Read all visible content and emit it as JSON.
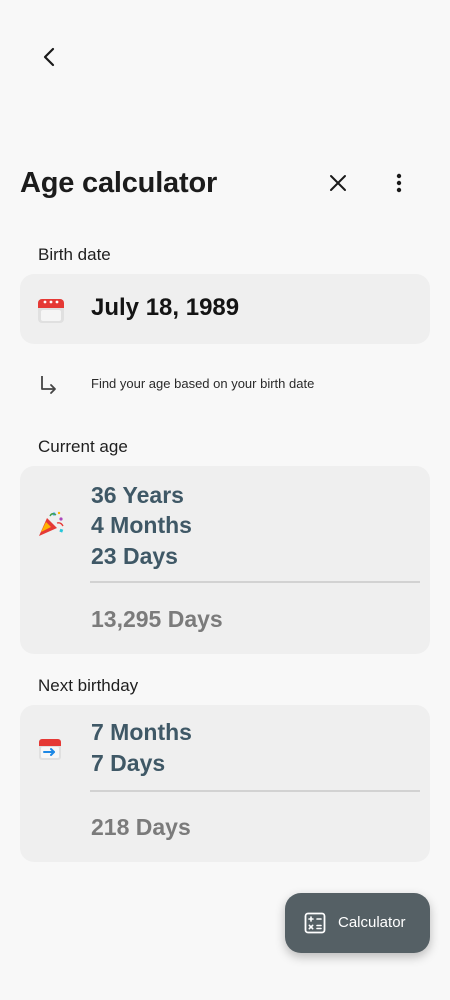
{
  "header": {
    "title": "Age calculator"
  },
  "birth_date": {
    "label": "Birth date",
    "value": "July 18, 1989",
    "hint": "Find your age based on your birth date"
  },
  "current_age": {
    "label": "Current age",
    "years": "36 Years",
    "months": "4 Months",
    "days": "23 Days",
    "total_days": "13,295 Days"
  },
  "next_birthday": {
    "label": "Next birthday",
    "months": "7 Months",
    "days": "7 Days",
    "total_days": "218 Days"
  },
  "fab": {
    "label": "Calculator"
  },
  "colors": {
    "background": "#f8f8f8",
    "card": "#efefef",
    "value_text": "#3f5866",
    "total_text": "#7b7b7b",
    "fab": "#556065"
  }
}
